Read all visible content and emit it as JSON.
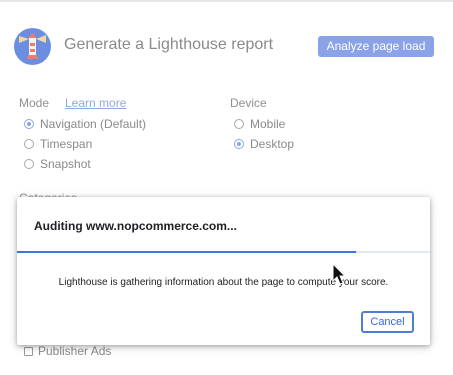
{
  "header": {
    "title": "Generate a Lighthouse report",
    "analyze_button": "Analyze page load",
    "logo_icon": "lighthouse-logo-icon"
  },
  "mode": {
    "label": "Mode",
    "learn_more": "Learn more",
    "options": [
      {
        "label": "Navigation (Default)",
        "checked": true
      },
      {
        "label": "Timespan",
        "checked": false
      },
      {
        "label": "Snapshot",
        "checked": false
      }
    ]
  },
  "device": {
    "label": "Device",
    "options": [
      {
        "label": "Mobile",
        "checked": false
      },
      {
        "label": "Desktop",
        "checked": true
      }
    ]
  },
  "categories": {
    "label": "Categories",
    "visible_items": [
      {
        "label": "Publisher Ads",
        "checked": false
      }
    ]
  },
  "dialog": {
    "title": "Auditing www.nopcommerce.com...",
    "progress_fraction": 0.82,
    "message": "Lighthouse is gathering information about the page to compute your score.",
    "cancel_button": "Cancel"
  },
  "colors": {
    "accent": "#8ba3e6",
    "progress": "#3c78d8",
    "link": "#8ea8e3",
    "cancel_border": "#4d7ecf"
  }
}
